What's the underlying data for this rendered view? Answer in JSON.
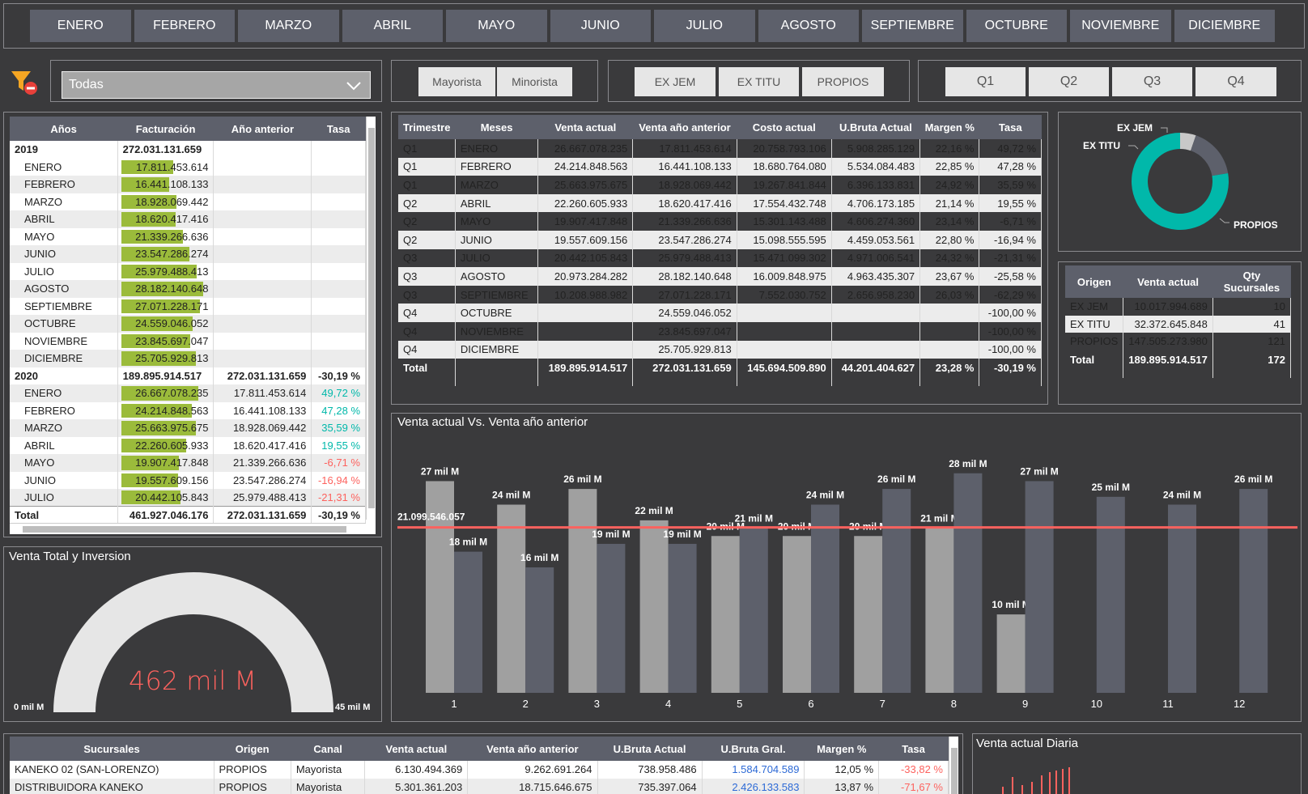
{
  "months_slicer": [
    "ENERO",
    "FEBRERO",
    "MARZO",
    "ABRIL",
    "MAYO",
    "JUNIO",
    "JULIO",
    "AGOSTO",
    "SEPTIEMBRE",
    "OCTUBRE",
    "NOVIEMBRE",
    "DICIEMBRE"
  ],
  "filter_dropdown": {
    "value": "Todas"
  },
  "canal_slicer": [
    "Mayorista",
    "Minorista"
  ],
  "origen_slicer": [
    "EX JEM",
    "EX TITU",
    "PROPIOS"
  ],
  "quarter_slicer": [
    "Q1",
    "Q2",
    "Q3",
    "Q4"
  ],
  "years_table": {
    "headers": [
      "Años",
      "Facturación",
      "Año anterior",
      "Tasa"
    ],
    "rows": [
      {
        "label": "2019",
        "fact": "272.031.131.659",
        "prev": "",
        "tasa": "",
        "bold": true,
        "v": 0
      },
      {
        "label": "ENERO",
        "fact": "17.811.453.614",
        "prev": "",
        "tasa": "",
        "v": 17.81
      },
      {
        "label": "FEBRERO",
        "fact": "16.441.108.133",
        "prev": "",
        "tasa": "",
        "v": 16.44
      },
      {
        "label": "MARZO",
        "fact": "18.928.069.442",
        "prev": "",
        "tasa": "",
        "v": 18.93
      },
      {
        "label": "ABRIL",
        "fact": "18.620.417.416",
        "prev": "",
        "tasa": "",
        "v": 18.62
      },
      {
        "label": "MAYO",
        "fact": "21.339.266.636",
        "prev": "",
        "tasa": "",
        "v": 21.34
      },
      {
        "label": "JUNIO",
        "fact": "23.547.286.274",
        "prev": "",
        "tasa": "",
        "v": 23.55
      },
      {
        "label": "JULIO",
        "fact": "25.979.488.413",
        "prev": "",
        "tasa": "",
        "v": 25.98
      },
      {
        "label": "AGOSTO",
        "fact": "28.182.140.648",
        "prev": "",
        "tasa": "",
        "v": 28.18
      },
      {
        "label": "SEPTIEMBRE",
        "fact": "27.071.228.171",
        "prev": "",
        "tasa": "",
        "v": 27.07
      },
      {
        "label": "OCTUBRE",
        "fact": "24.559.046.052",
        "prev": "",
        "tasa": "",
        "v": 24.56
      },
      {
        "label": "NOVIEMBRE",
        "fact": "23.845.697.047",
        "prev": "",
        "tasa": "",
        "v": 23.85
      },
      {
        "label": "DICIEMBRE",
        "fact": "25.705.929.813",
        "prev": "",
        "tasa": "",
        "v": 25.71
      },
      {
        "label": "2020",
        "fact": "189.895.914.517",
        "prev": "272.031.131.659",
        "tasa": "-30,19 %",
        "bold": true,
        "v": 0
      },
      {
        "label": "ENERO",
        "fact": "26.667.078.235",
        "prev": "17.811.453.614",
        "tasa": "49,72 %",
        "v": 26.67,
        "cls": "pos"
      },
      {
        "label": "FEBRERO",
        "fact": "24.214.848.563",
        "prev": "16.441.108.133",
        "tasa": "47,28 %",
        "v": 24.21,
        "cls": "pos"
      },
      {
        "label": "MARZO",
        "fact": "25.663.975.675",
        "prev": "18.928.069.442",
        "tasa": "35,59 %",
        "v": 25.66,
        "cls": "pos"
      },
      {
        "label": "ABRIL",
        "fact": "22.260.605.933",
        "prev": "18.620.417.416",
        "tasa": "19,55 %",
        "v": 22.26,
        "cls": "pos"
      },
      {
        "label": "MAYO",
        "fact": "19.907.417.848",
        "prev": "21.339.266.636",
        "tasa": "-6,71 %",
        "v": 19.91,
        "cls": "neg"
      },
      {
        "label": "JUNIO",
        "fact": "19.557.609.156",
        "prev": "23.547.286.274",
        "tasa": "-16,94 %",
        "v": 19.56,
        "cls": "neg"
      },
      {
        "label": "JULIO",
        "fact": "20.442.105.843",
        "prev": "25.979.488.413",
        "tasa": "-21,31 %",
        "v": 20.44,
        "cls": "neg"
      }
    ],
    "total": {
      "label": "Total",
      "fact": "461.927.046.176",
      "prev": "272.031.131.659",
      "tasa": "-30,19 %"
    }
  },
  "quarter_table": {
    "headers": [
      "Trimestre",
      "Meses",
      "Venta actual",
      "Venta año anterior",
      "Costo actual",
      "U.Bruta Actual",
      "Margen %",
      "Tasa"
    ],
    "rows": [
      [
        "Q1",
        "ENERO",
        "26.667.078.235",
        "17.811.453.614",
        "20.758.793.106",
        "5.908.285.129",
        "22,16 %",
        "49,72 %"
      ],
      [
        "Q1",
        "FEBRERO",
        "24.214.848.563",
        "16.441.108.133",
        "18.680.764.080",
        "5.534.084.483",
        "22,85 %",
        "47,28 %"
      ],
      [
        "Q1",
        "MARZO",
        "25.663.975.675",
        "18.928.069.442",
        "19.267.841.844",
        "6.396.133.831",
        "24,92 %",
        "35,59 %"
      ],
      [
        "Q2",
        "ABRIL",
        "22.260.605.933",
        "18.620.417.416",
        "17.554.432.748",
        "4.706.173.185",
        "21,14 %",
        "19,55 %"
      ],
      [
        "Q2",
        "MAYO",
        "19.907.417.848",
        "21.339.266.636",
        "15.301.143.488",
        "4.606.274.360",
        "23,14 %",
        "-6,71 %"
      ],
      [
        "Q2",
        "JUNIO",
        "19.557.609.156",
        "23.547.286.274",
        "15.098.555.595",
        "4.459.053.561",
        "22,80 %",
        "-16,94 %"
      ],
      [
        "Q3",
        "JULIO",
        "20.442.105.843",
        "25.979.488.413",
        "15.471.099.302",
        "4.971.006.541",
        "24,32 %",
        "-21,31 %"
      ],
      [
        "Q3",
        "AGOSTO",
        "20.973.284.282",
        "28.182.140.648",
        "16.009.848.975",
        "4.963.435.307",
        "23,67 %",
        "-25,58 %"
      ],
      [
        "Q3",
        "SEPTIEMBRE",
        "10.208.988.982",
        "27.071.228.171",
        "7.552.030.752",
        "2.656.958.230",
        "26,03 %",
        "-62,29 %"
      ],
      [
        "Q4",
        "OCTUBRE",
        "",
        "24.559.046.052",
        "",
        "",
        "",
        "-100,00 %"
      ],
      [
        "Q4",
        "NOVIEMBRE",
        "",
        "23.845.697.047",
        "",
        "",
        "",
        "-100,00 %"
      ],
      [
        "Q4",
        "DICIEMBRE",
        "",
        "25.705.929.813",
        "",
        "",
        "",
        "-100,00 %"
      ]
    ],
    "total": [
      "Total",
      "",
      "189.895.914.517",
      "272.031.131.659",
      "145.694.509.890",
      "44.201.404.627",
      "23,28 %",
      "-30,19 %"
    ]
  },
  "donut": {
    "labels": [
      "EX JEM",
      "EX TITU",
      "PROPIOS"
    ],
    "values": [
      10017994689,
      32372645848,
      147505273980
    ],
    "colors": [
      "#c8c8c8",
      "#5d606b",
      "#01b8aa"
    ]
  },
  "origen_table": {
    "headers": [
      "Origen",
      "Venta actual",
      "Qty Sucursales"
    ],
    "rows": [
      [
        "EX JEM",
        "10.017.994.689",
        "10"
      ],
      [
        "EX TITU",
        "32.372.645.848",
        "41"
      ],
      [
        "PROPIOS",
        "147.505.273.980",
        "121"
      ]
    ],
    "total": [
      "Total",
      "189.895.914.517",
      "172"
    ]
  },
  "bar_chart_title": "Venta actual Vs. Venta año anterior",
  "chart_data": {
    "type": "bar",
    "categories": [
      "1",
      "2",
      "3",
      "4",
      "5",
      "6",
      "7",
      "8",
      "9",
      "10",
      "11",
      "12"
    ],
    "series": [
      {
        "values": [
          27,
          24,
          26,
          22,
          20,
          20,
          20,
          21,
          10,
          null,
          null,
          null
        ],
        "labels": [
          "27 mil M",
          "24 mil M",
          "26 mil M",
          "22 mil M",
          "20 mil M",
          "20 mil M",
          "20 mil M",
          "21 mil M",
          "10 mil M",
          "",
          "",
          ""
        ],
        "color": "#a0a0a0"
      },
      {
        "values": [
          18,
          16,
          19,
          19,
          21,
          24,
          26,
          28,
          27,
          25,
          24,
          26
        ],
        "labels": [
          "18 mil M",
          "16 mil M",
          "19 mil M",
          "19 mil M",
          "21 mil M",
          "24 mil M",
          "26 mil M",
          "28 mil M",
          "27 mil M",
          "25 mil M",
          "24 mil M",
          "26 mil M"
        ],
        "color": "#5d606b"
      }
    ],
    "reference_line": {
      "value": 21.099546057,
      "label": "21.099.546.057",
      "color": "#fd625e"
    },
    "ylim": [
      0,
      32
    ]
  },
  "gauge": {
    "title": "Venta Total y Inversion",
    "value_label": "462 mil M",
    "min_label": "0 mil M",
    "max_label": "45 mil M",
    "fill": 1
  },
  "branch_table": {
    "headers": [
      "Sucursales",
      "Origen",
      "Canal",
      "Venta actual",
      "Venta año anterior",
      "U.Bruta Actual",
      "U.Bruta Gral.",
      "Margen %",
      "Tasa"
    ],
    "rows": [
      [
        "KANEKO 02 (SAN-LORENZO)",
        "PROPIOS",
        "Mayorista",
        "6.130.494.369",
        "9.262.691.264",
        "738.958.486",
        "1.584.704.589",
        "12,05 %",
        "-33,82 %"
      ],
      [
        "DISTRIBUIDORA KANEKO",
        "PROPIOS",
        "Mayorista",
        "5.301.361.203",
        "18.715.646.675",
        "735.397.064",
        "2.426.133.583",
        "13,87 %",
        "-71,67 %"
      ]
    ]
  },
  "daily_title": "Venta actual Diaria"
}
